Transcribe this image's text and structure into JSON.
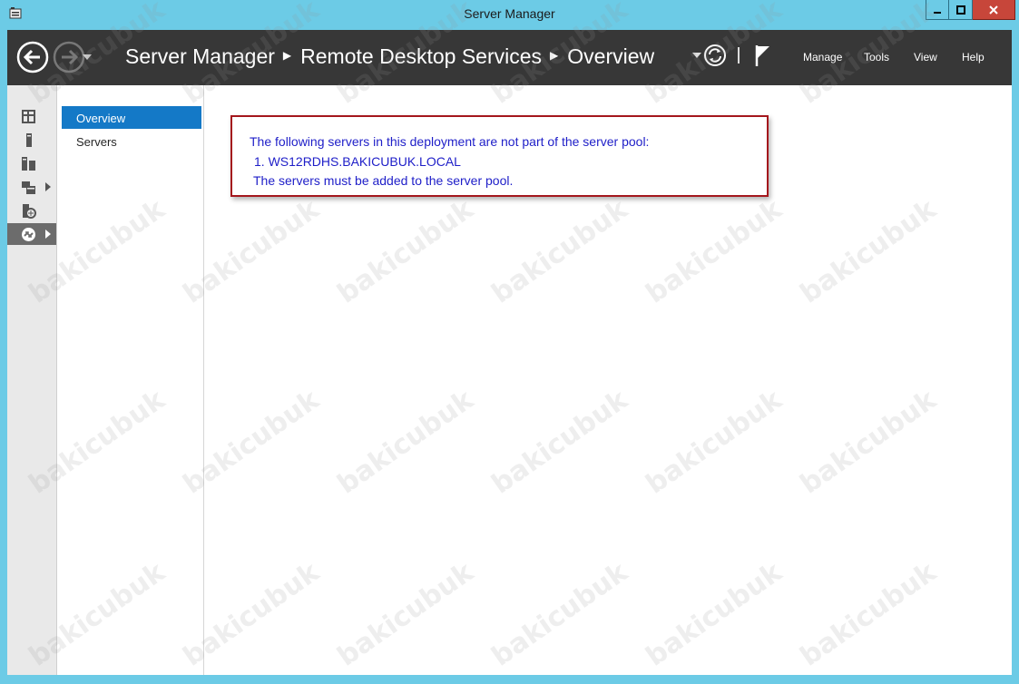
{
  "window": {
    "title": "Server Manager"
  },
  "header": {
    "breadcrumb": [
      "Server Manager",
      "Remote Desktop Services",
      "Overview"
    ],
    "menu": [
      "Manage",
      "Tools",
      "View",
      "Help"
    ]
  },
  "left_nav": {
    "icons": [
      "dashboard-icon",
      "local-server-icon",
      "all-servers-icon",
      "file-storage-icon",
      "iis-icon",
      "remote-desktop-icon"
    ]
  },
  "panel": {
    "items": [
      "Overview",
      "Servers"
    ],
    "selected": "Overview"
  },
  "message": {
    "line1": "The following servers in this deployment are not part of the server pool:",
    "line2": "1. WS12RDHS.BAKICUBUK.LOCAL",
    "line3": "The servers must be added to the server pool."
  },
  "watermark": "bakicubuk",
  "colors": {
    "accent": "#1479c7",
    "header_bg": "#373737",
    "frame": "#6ccbe6",
    "message_text": "#1e1ec8",
    "message_border": "#a4171d"
  }
}
